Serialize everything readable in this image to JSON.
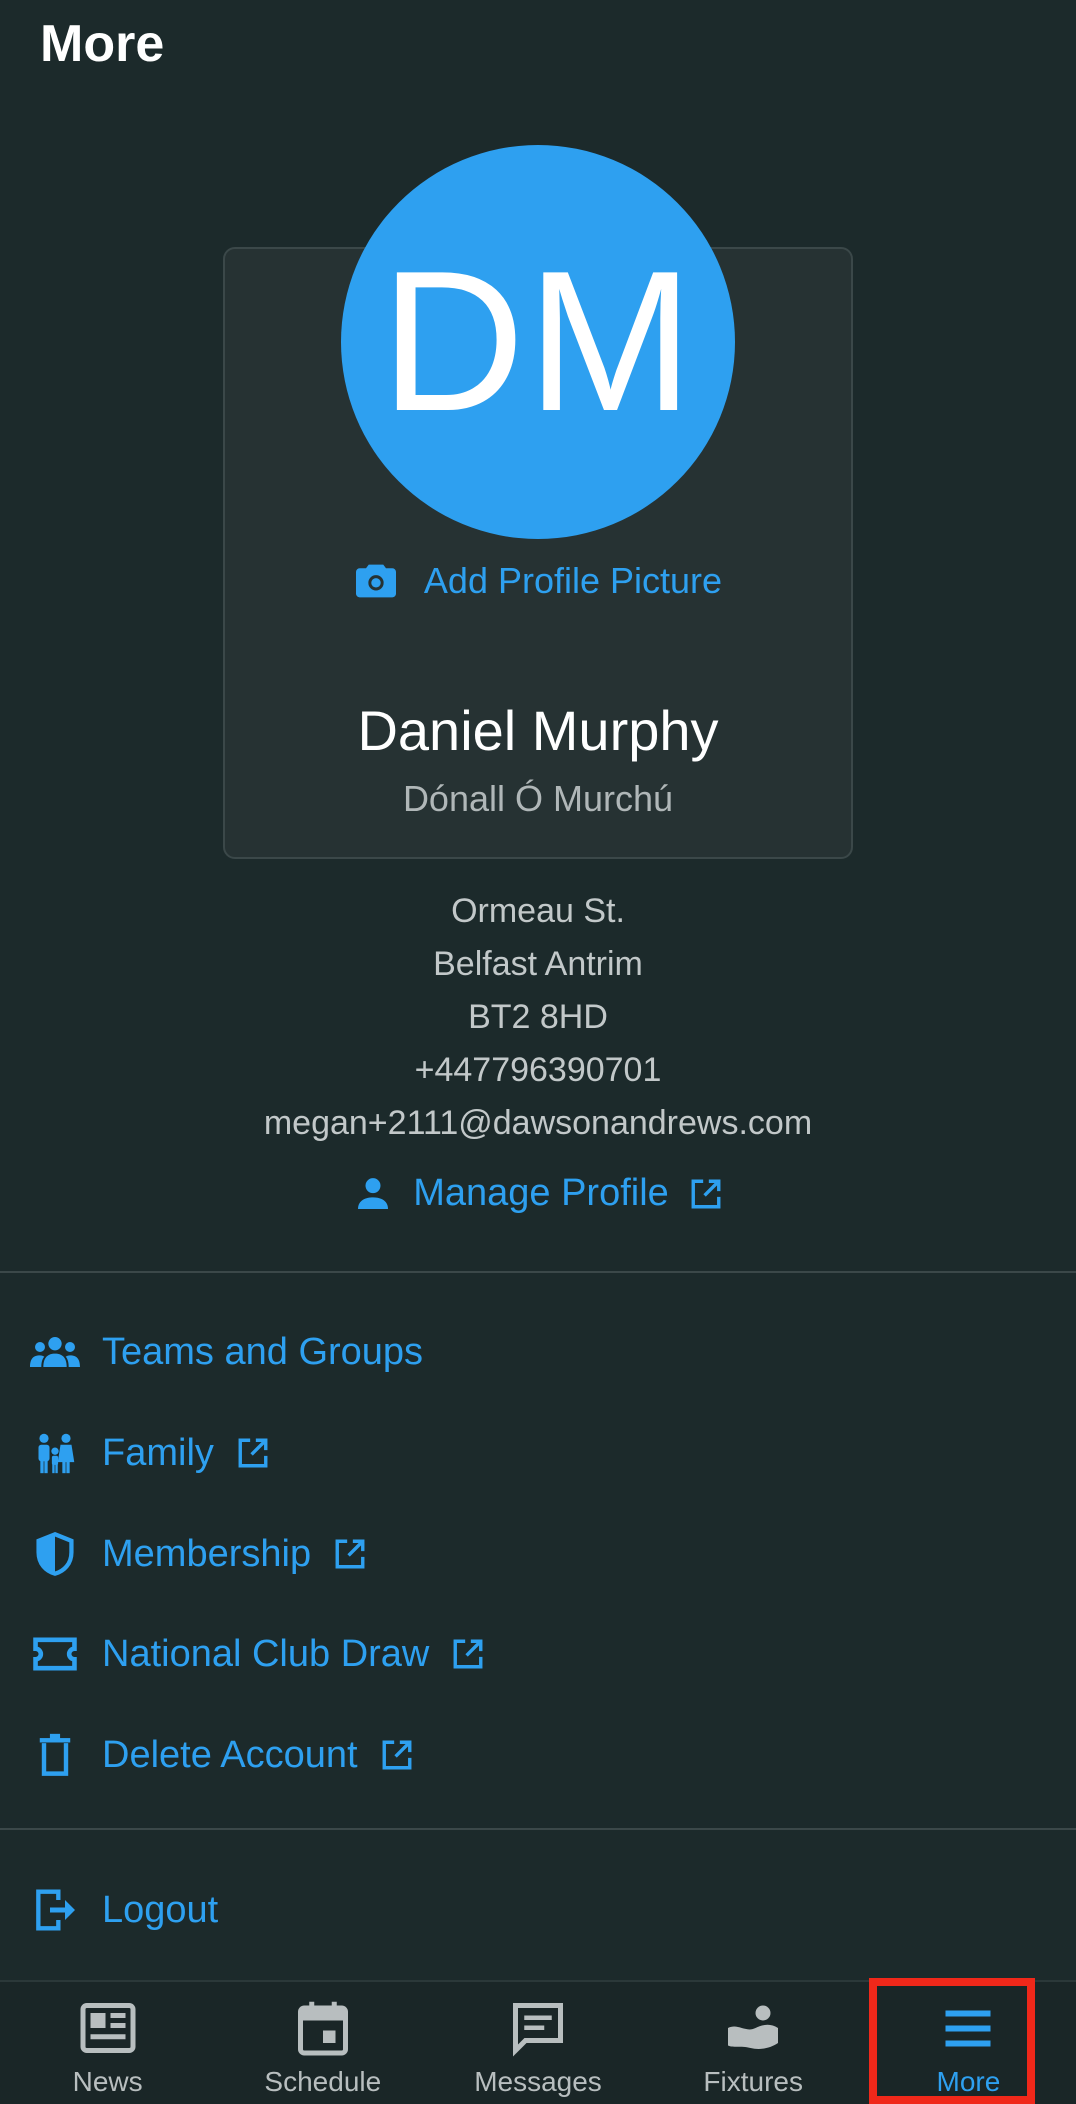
{
  "header": {
    "title": "More"
  },
  "profile": {
    "initials": "DM",
    "add_picture_label": "Add Profile Picture",
    "full_name": "Daniel Murphy",
    "alt_name": "Dónall Ó Murchú",
    "address_line1": "Ormeau St.",
    "address_line2": "Belfast Antrim",
    "postcode": "BT2 8HD",
    "phone": "+447796390701",
    "email": "megan+2111@dawsonandrews.com",
    "manage_label": "Manage Profile",
    "avatar_color": "#2ea0f0"
  },
  "menu": {
    "teams": "Teams and Groups",
    "family": "Family",
    "membership": "Membership",
    "draw": "National Club Draw",
    "delete": "Delete Account",
    "logout": "Logout"
  },
  "tabs": {
    "news": "News",
    "schedule": "Schedule",
    "messages": "Messages",
    "fixtures": "Fixtures",
    "more": "More",
    "active": "More"
  },
  "colors": {
    "accent": "#2ea0f0",
    "background": "#1c2a2b",
    "highlight": "#f0281a"
  }
}
